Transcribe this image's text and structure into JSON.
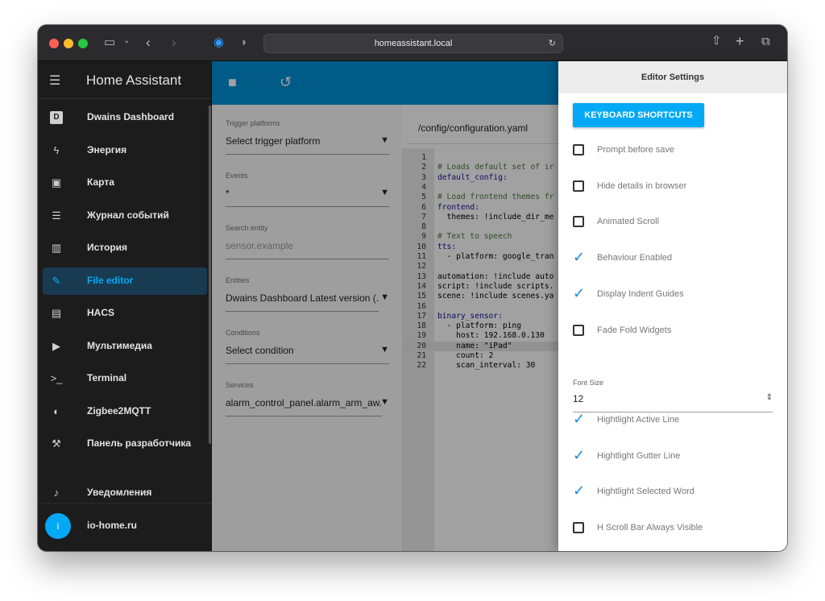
{
  "browser": {
    "url": "homeassistant.local",
    "colors": {
      "close": "#ff5f57",
      "minimize": "#febc2e",
      "zoom": "#28c840"
    }
  },
  "sidebar": {
    "title": "Home Assistant",
    "items": [
      {
        "label": "Dwains Dashboard",
        "icon": "D"
      },
      {
        "label": "Энергия",
        "icon": "ϟ"
      },
      {
        "label": "Карта",
        "icon": "▣"
      },
      {
        "label": "Журнал событий",
        "icon": "☰"
      },
      {
        "label": "История",
        "icon": "▥"
      },
      {
        "label": "File editor",
        "icon": "✎"
      },
      {
        "label": "HACS",
        "icon": "▤"
      },
      {
        "label": "Мультимедиа",
        "icon": "▶"
      },
      {
        "label": "Terminal",
        "icon": ">_"
      },
      {
        "label": "Zigbee2MQTT",
        "icon": "◐"
      },
      {
        "label": "Панель разработчика",
        "icon": "⚒"
      }
    ],
    "notifications": "Уведомления",
    "user": {
      "initial": "i",
      "name": "io-home.ru"
    },
    "accent": "#03a9f4"
  },
  "form": {
    "trigger": {
      "label": "Trigger platforms",
      "value": "Select trigger platform"
    },
    "events": {
      "label": "Events",
      "value": "*"
    },
    "search": {
      "label": "Search entity",
      "placeholder": "sensor.example"
    },
    "entities": {
      "label": "Entities",
      "value": "Dwains Dashboard Latest version (..."
    },
    "conditions": {
      "label": "Conditions",
      "value": "Select condition"
    },
    "services": {
      "label": "Services",
      "value": "alarm_control_panel.alarm_arm_aw..."
    }
  },
  "editor": {
    "path": "/config/configuration.yaml",
    "lines": [
      {
        "n": "1",
        "text": "",
        "kind": "plain"
      },
      {
        "n": "2",
        "text": "# Loads default set of ir",
        "kind": "comment"
      },
      {
        "n": "3",
        "text": "default_config:",
        "kind": "key"
      },
      {
        "n": "4",
        "text": "",
        "kind": "plain"
      },
      {
        "n": "5",
        "text": "# Load frontend themes fr",
        "kind": "comment"
      },
      {
        "n": "6",
        "text": "frontend:",
        "kind": "key"
      },
      {
        "n": "7",
        "text": "  themes: !include_dir_me",
        "kind": "plain"
      },
      {
        "n": "8",
        "text": "",
        "kind": "plain"
      },
      {
        "n": "9",
        "text": "# Text to speech",
        "kind": "comment"
      },
      {
        "n": "10",
        "text": "tts:",
        "kind": "key"
      },
      {
        "n": "11",
        "text": "  - platform: google_tran",
        "kind": "plain"
      },
      {
        "n": "12",
        "text": "",
        "kind": "plain"
      },
      {
        "n": "13",
        "text": "automation: !include auto",
        "kind": "plain"
      },
      {
        "n": "14",
        "text": "script: !include scripts.",
        "kind": "plain"
      },
      {
        "n": "15",
        "text": "scene: !include scenes.ya",
        "kind": "plain"
      },
      {
        "n": "16",
        "text": "",
        "kind": "plain"
      },
      {
        "n": "17",
        "text": "binary_sensor:",
        "kind": "key"
      },
      {
        "n": "18",
        "text": "  - platform: ping",
        "kind": "plain"
      },
      {
        "n": "19",
        "text": "    host: 192.168.0.130",
        "kind": "plain"
      },
      {
        "n": "20",
        "text": "    name: \"iPad\"",
        "kind": "plain"
      },
      {
        "n": "21",
        "text": "    count: 2",
        "kind": "plain"
      },
      {
        "n": "22",
        "text": "    scan_interval: 30",
        "kind": "plain"
      }
    ]
  },
  "settings": {
    "title": "Editor Settings",
    "shortcuts_button": "KEYBOARD SHORTCUTS",
    "options": [
      {
        "label": "Prompt before save",
        "checked": false
      },
      {
        "label": "Hide details in browser",
        "checked": false
      },
      {
        "label": "Animated Scroll",
        "checked": false
      },
      {
        "label": "Behaviour Enabled",
        "checked": true
      },
      {
        "label": "Display Indent Guides",
        "checked": true
      },
      {
        "label": "Fade Fold Widgets",
        "checked": false
      }
    ],
    "font_size": {
      "label": "Font Size",
      "value": "12"
    },
    "options2": [
      {
        "label": "Hightlight Active Line",
        "checked": true
      },
      {
        "label": "Hightlight Gutter Line",
        "checked": true
      },
      {
        "label": "Hightlight Selected Word",
        "checked": true
      },
      {
        "label": "H Scroll Bar Always Visible",
        "checked": false
      }
    ]
  }
}
